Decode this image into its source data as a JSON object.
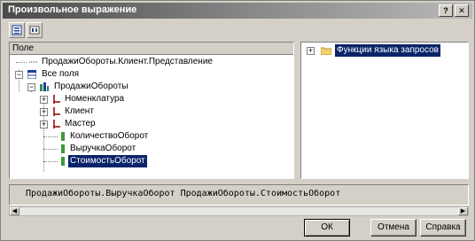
{
  "window": {
    "title": "Произвольное выражение",
    "help_glyph": "?",
    "close_glyph": "✕"
  },
  "toolbar": {
    "tools": [
      {
        "name": "list-view-icon"
      },
      {
        "name": "field-view-icon"
      }
    ]
  },
  "fields_panel": {
    "column_header": "Поле",
    "rows": [
      {
        "label": "ПродажиОбороты.Клиент.Представление",
        "icon": "field-dotted-icon"
      },
      {
        "label": "Все поля",
        "icon": "table-icon",
        "expanded": true
      },
      {
        "label": "ПродажиОбороты",
        "icon": "register-icon",
        "expanded": true
      },
      {
        "label": "Номенклатура",
        "icon": "reference-icon",
        "expanded": false
      },
      {
        "label": "Клиент",
        "icon": "reference-icon",
        "expanded": false
      },
      {
        "label": "Мастер",
        "icon": "reference-icon",
        "expanded": false
      },
      {
        "label": "КоличествоОборот",
        "icon": "resource-icon"
      },
      {
        "label": "ВыручкаОборот",
        "icon": "resource-icon"
      },
      {
        "label": "СтоимостьОборот",
        "icon": "resource-icon",
        "selected": true
      }
    ]
  },
  "functions_panel": {
    "rows": [
      {
        "label": "Функции языка запросов",
        "icon": "folder-icon",
        "selected": true,
        "expanded": false
      }
    ]
  },
  "expression": {
    "text": "ПродажиОбороты.ВыручкаОборот ПродажиОбороты.СтоимостьОборот"
  },
  "buttons": {
    "ok": "ОК",
    "cancel": "Отмена",
    "help": "Справка"
  },
  "colors": {
    "selection": "#0a246a",
    "dialog_bg": "#d4d0c8"
  }
}
